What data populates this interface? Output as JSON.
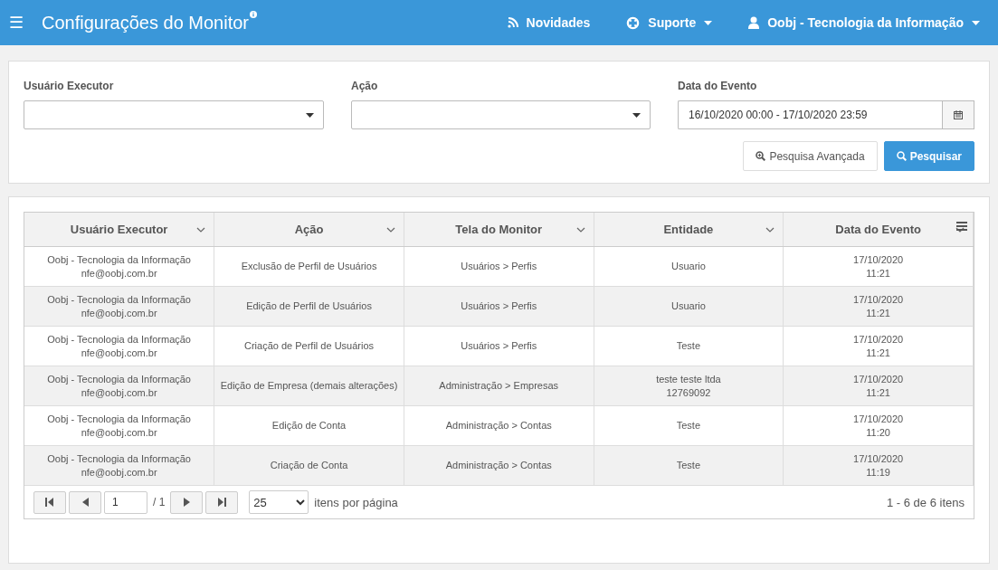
{
  "header": {
    "menu_icon": "☰",
    "title": "Configurações do Monitor",
    "nav": [
      {
        "kind": "news",
        "label": "Novidades"
      },
      {
        "kind": "support",
        "label": "Suporte",
        "dropdown": true
      },
      {
        "kind": "user",
        "label": "Oobj - Tecnologia da Informação",
        "dropdown": true
      }
    ]
  },
  "filters": {
    "fields": [
      {
        "kind": "select",
        "label": "Usuário Executor"
      },
      {
        "kind": "select",
        "label": "Ação"
      },
      {
        "kind": "date",
        "label": "Data do Evento",
        "value": "16/10/2020 00:00 - 17/10/2020 23:59"
      }
    ],
    "buttons": [
      {
        "kind": "secondary",
        "label": "Pesquisa Avançada"
      },
      {
        "kind": "primary",
        "label": "Pesquisar"
      }
    ]
  },
  "table": {
    "columns": [
      "Usuário Executor",
      "Ação",
      "Tela do Monitor",
      "Entidade",
      "Data do Evento"
    ],
    "rows": [
      [
        "Oobj - Tecnologia da Informação\nnfe@oobj.com.br",
        "Exclusão de Perfil de Usuários",
        "Usuários > Perfis",
        "Usuario",
        "17/10/2020\n11:21"
      ],
      [
        "Oobj - Tecnologia da Informação\nnfe@oobj.com.br",
        "Edição de Perfil de Usuários",
        "Usuários > Perfis",
        "Usuario",
        "17/10/2020\n11:21"
      ],
      [
        "Oobj - Tecnologia da Informação\nnfe@oobj.com.br",
        "Criação de Perfil de Usuários",
        "Usuários > Perfis",
        "Teste",
        "17/10/2020\n11:21"
      ],
      [
        "Oobj - Tecnologia da Informação\nnfe@oobj.com.br",
        "Edição de Empresa (demais alterações)",
        "Administração > Empresas",
        "teste teste ltda\n12769092",
        "17/10/2020\n11:21"
      ],
      [
        "Oobj - Tecnologia da Informação\nnfe@oobj.com.br",
        "Edição de Conta",
        "Administração > Contas",
        "Teste",
        "17/10/2020\n11:20"
      ],
      [
        "Oobj - Tecnologia da Informação\nnfe@oobj.com.br",
        "Criação de Conta",
        "Administração > Contas",
        "Teste",
        "17/10/2020\n11:19"
      ]
    ]
  },
  "pager": {
    "page": "1",
    "of": "/ 1",
    "page_size": "25",
    "page_size_label": "itens por página",
    "summary": "1 - 6 de 6 itens"
  }
}
